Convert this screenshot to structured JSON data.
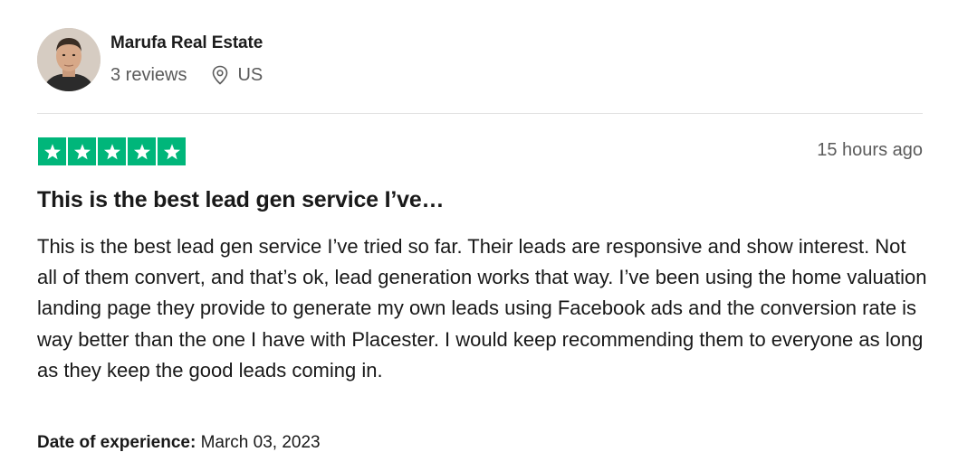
{
  "consumer": {
    "name": "Marufa Real Estate",
    "reviews_count": "3 reviews",
    "country": "US"
  },
  "review": {
    "rating": 5,
    "star_color": "#00b67a",
    "time_ago": "15 hours ago",
    "title": "This is the best lead gen service I’ve…",
    "body": "This is the best lead gen service I’ve tried so far. Their leads are responsive and show interest. Not all of them convert, and that’s ok, lead generation works that way. I’ve been using the home valuation landing page they provide to generate my own leads using Facebook ads and the conversion rate is way better than the one I have with Placester. I would keep recommending them to everyone as long as they keep the good leads coming in.",
    "experience_label": "Date of experience:",
    "experience_date": "March 03, 2023"
  },
  "icons": {
    "avatar": "user-avatar-photo",
    "location": "map-pin-icon",
    "star": "star-icon"
  }
}
